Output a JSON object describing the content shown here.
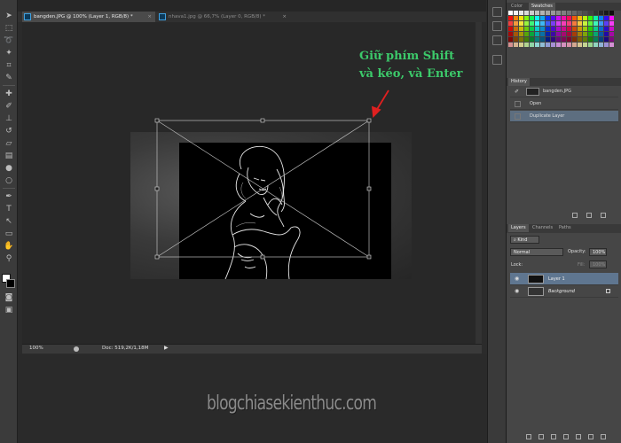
{
  "tabs": [
    {
      "label": "bangden.JPG @ 100% (Layer 1, RGB/8) *",
      "close": "×"
    },
    {
      "label": "nhava1.jpg @ 66,7% (Layer 0, RGB/8) *",
      "close": "×"
    }
  ],
  "annotation": {
    "line1": "Giữ phím Shift",
    "line2": "và kéo, và Enter"
  },
  "status": {
    "zoom": "100%",
    "doc": "Doc: 519,2K/1,18M",
    "arrow": "▶"
  },
  "watermark": "blogchiasekienthuc.com",
  "color_panel": {
    "tabs": [
      "Color",
      "Swatches"
    ]
  },
  "history": {
    "title": "History",
    "snapshot": "bangden.JPG",
    "items": [
      "Open",
      "Duplicate Layer"
    ]
  },
  "layers": {
    "tabs": [
      "Layers",
      "Channels",
      "Paths"
    ],
    "kind": "Kind",
    "blend_mode": "Normal",
    "opacity_label": "Opacity:",
    "opacity_value": "100%",
    "lock_label": "Lock:",
    "fill_label": "Fill:",
    "fill_value": "100%",
    "items": [
      "Layer 1",
      "Background"
    ]
  },
  "icons": [
    "move-icon",
    "marquee-icon",
    "lasso-icon",
    "magic-wand-icon",
    "crop-icon",
    "eyedropper-icon",
    "healing-icon",
    "brush-icon",
    "stamp-icon",
    "history-brush-icon",
    "eraser-icon",
    "gradient-icon",
    "blur-icon",
    "dodge-icon",
    "pen-icon",
    "type-icon",
    "path-select-icon",
    "shape-icon",
    "hand-icon",
    "zoom-icon"
  ]
}
